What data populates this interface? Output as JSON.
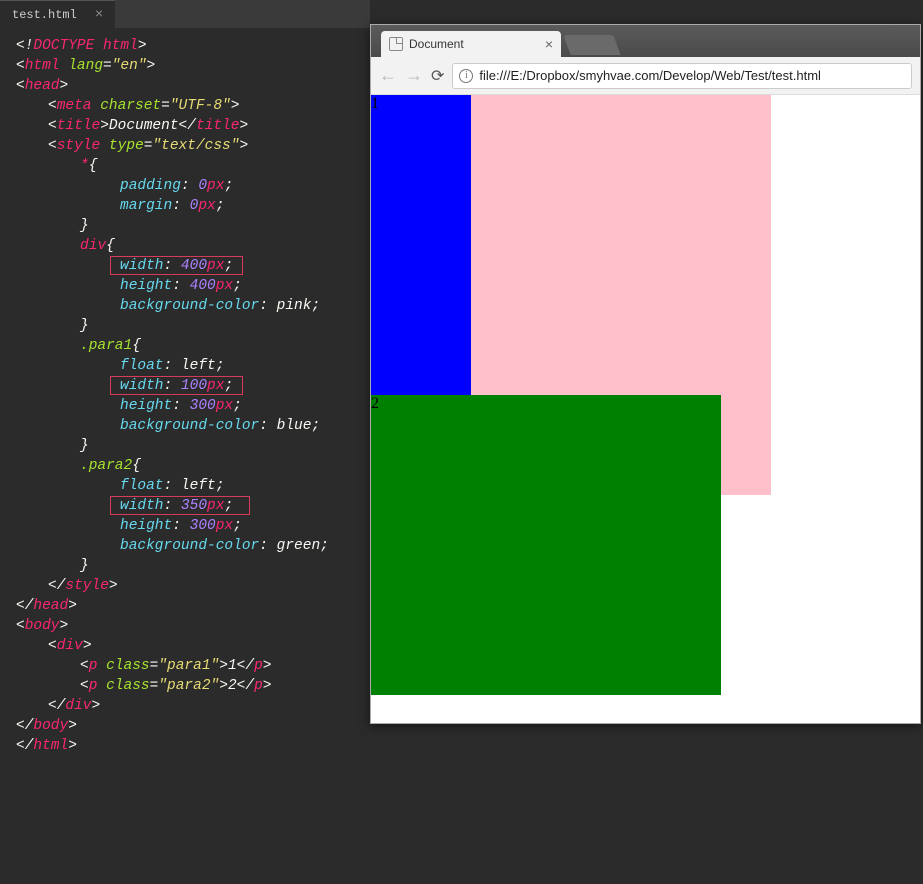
{
  "editor": {
    "tab_name": "test.html",
    "code": {
      "doctype": "DOCTYPE html",
      "html_attr_name": "lang",
      "html_attr_val": "\"en\"",
      "meta_attr_name": "charset",
      "meta_attr_val": "\"UTF-8\"",
      "title_text": "Document",
      "style_attr_name": "type",
      "style_attr_val": "\"text/css\"",
      "sel_star": "*",
      "sel_div": "div",
      "sel_p1": ".para1",
      "sel_p2": ".para2",
      "prop_padding": "padding",
      "prop_margin": "margin",
      "prop_width": "width",
      "prop_height": "height",
      "prop_bg": "background-color",
      "prop_float": "float",
      "val_0px": "0",
      "val_400": "400",
      "val_100": "100",
      "val_300": "300",
      "val_350": "350",
      "val_px": "px",
      "val_pink": "pink",
      "val_blue": "blue",
      "val_green": "green",
      "val_left": "left",
      "p1_class": "\"para1\"",
      "p2_class": "\"para2\"",
      "p1_text": "1",
      "p2_text": "2",
      "class_attr": "class"
    },
    "highlights": [
      {
        "line": "div width 400px"
      },
      {
        "line": ".para1 width 100px"
      },
      {
        "line": ".para2 width 350px"
      }
    ]
  },
  "browser": {
    "tab_title": "Document",
    "url": "file:///E:/Dropbox/smyhvae.com/Develop/Web/Test/test.html",
    "rendered": {
      "para1_text": "1",
      "para2_text": "2",
      "div_bg": "pink",
      "para1_bg": "blue",
      "para2_bg": "green"
    }
  }
}
